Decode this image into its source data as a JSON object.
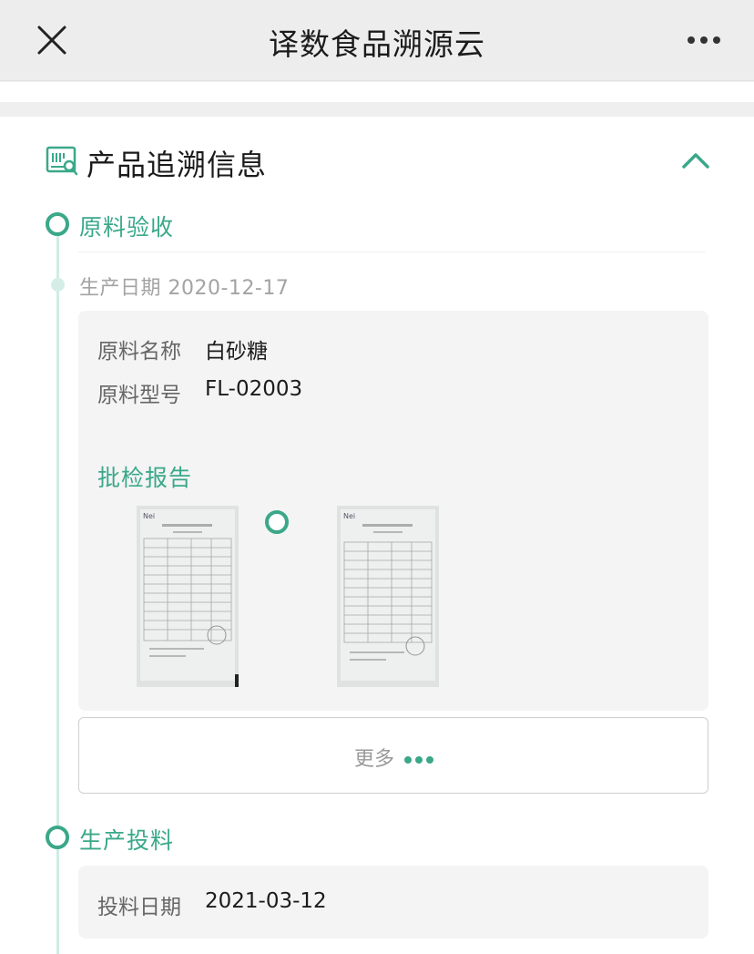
{
  "header": {
    "title": "译数食品溯源云",
    "close_icon": "close-icon",
    "more_icon": "more-horizontal-icon"
  },
  "section": {
    "title": "产品追溯信息",
    "icon": "barcode-search-icon",
    "collapse_icon": "chevron-up-icon"
  },
  "accent_color": "#3aa889",
  "stages": [
    {
      "title": "原料验收",
      "date_label": "生产日期",
      "date": "2020-12-17",
      "fields": [
        {
          "label": "原料名称",
          "value": "白砂糖"
        },
        {
          "label": "原料型号",
          "value": "FL-02003"
        }
      ],
      "report_title": "批检报告",
      "reports": [
        {
          "name": "report-image-1"
        },
        {
          "name": "report-image-2"
        }
      ],
      "more_label": "更多"
    },
    {
      "title": "生产投料",
      "fields": [
        {
          "label": "投料日期",
          "value": "2021-03-12"
        }
      ]
    }
  ]
}
